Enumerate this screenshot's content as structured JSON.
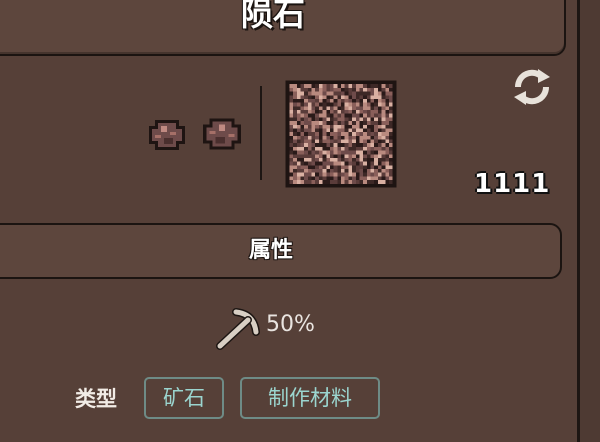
{
  "item": {
    "name": "陨石",
    "count": "1111"
  },
  "section": {
    "attributes_label": "属性"
  },
  "stats": {
    "tool_power": "50%"
  },
  "category": {
    "label": "类型",
    "tags": [
      "矿石",
      "制作材料"
    ]
  },
  "icons": {
    "refresh": "refresh-icon",
    "pickaxe": "pickaxe-icon",
    "ore_small": "meteorite-ore-icon",
    "block": "meteorite-block-icon"
  },
  "colors": {
    "panel": "#564038",
    "tag_text": "#9bd5cf",
    "tag_border": "#6e8b86"
  }
}
